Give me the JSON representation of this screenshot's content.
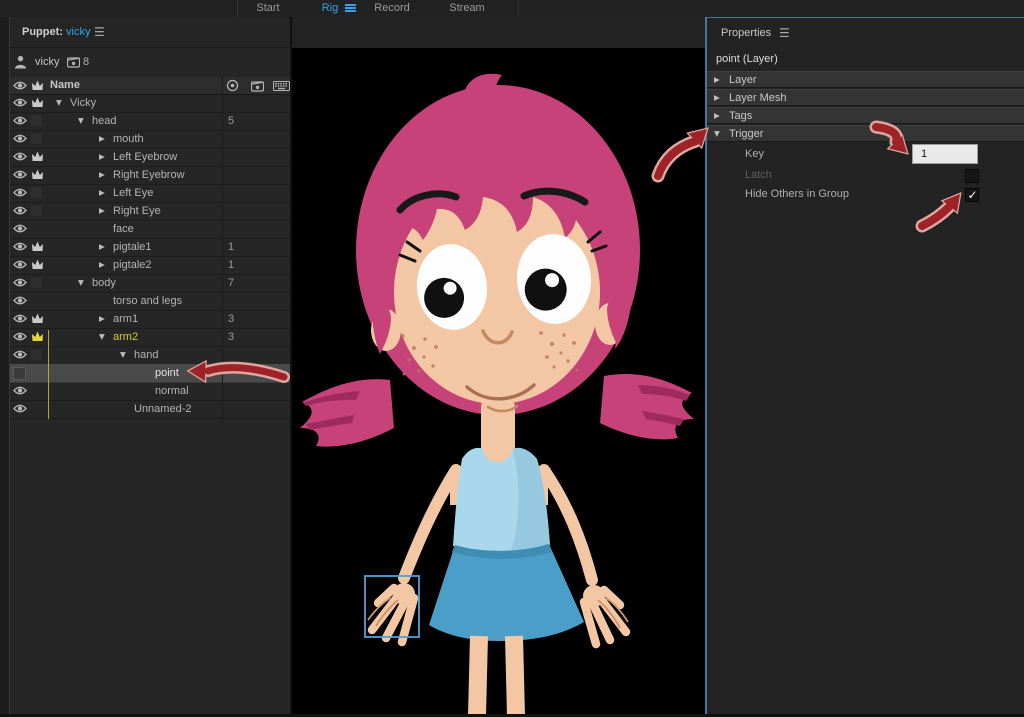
{
  "app": {
    "tabs": [
      {
        "label": "Start",
        "active": false
      },
      {
        "label": "Rig",
        "active": true
      },
      {
        "label": "Record",
        "active": false
      },
      {
        "label": "Stream",
        "active": false
      }
    ]
  },
  "puppet_panel": {
    "title_prefix": "Puppet:",
    "title_name": "vicky",
    "puppet_name": "vicky",
    "trigger_badge_count": "8",
    "name_column_header": "Name",
    "rows": [
      {
        "name": "Vicky",
        "indent": 0,
        "disclosure": "open",
        "eye": true,
        "badge": "crown",
        "value": ""
      },
      {
        "name": "head",
        "indent": 1,
        "disclosure": "open",
        "eye": true,
        "badge": "square",
        "value": "5"
      },
      {
        "name": "mouth",
        "indent": 2,
        "disclosure": "closed",
        "eye": true,
        "badge": "square",
        "value": ""
      },
      {
        "name": "Left Eyebrow",
        "indent": 2,
        "disclosure": "closed",
        "eye": true,
        "badge": "crown",
        "value": ""
      },
      {
        "name": "Right Eyebrow",
        "indent": 2,
        "disclosure": "closed",
        "eye": true,
        "badge": "crown",
        "value": ""
      },
      {
        "name": "Left Eye",
        "indent": 2,
        "disclosure": "closed",
        "eye": true,
        "badge": "square",
        "value": ""
      },
      {
        "name": "Right Eye",
        "indent": 2,
        "disclosure": "closed",
        "eye": true,
        "badge": "square",
        "value": ""
      },
      {
        "name": "face",
        "indent": 2,
        "disclosure": "none",
        "eye": true,
        "badge": "none",
        "value": ""
      },
      {
        "name": "pigtale1",
        "indent": 2,
        "disclosure": "closed",
        "eye": true,
        "badge": "crown",
        "value": "1"
      },
      {
        "name": "pigtale2",
        "indent": 2,
        "disclosure": "closed",
        "eye": true,
        "badge": "crown",
        "value": "1"
      },
      {
        "name": "body",
        "indent": 1,
        "disclosure": "open",
        "eye": true,
        "badge": "square",
        "value": "7"
      },
      {
        "name": "torso and legs",
        "indent": 2,
        "disclosure": "none",
        "eye": true,
        "badge": "none",
        "value": ""
      },
      {
        "name": "arm1",
        "indent": 2,
        "disclosure": "closed",
        "eye": true,
        "badge": "crown",
        "value": "3"
      },
      {
        "name": "arm2",
        "indent": 2,
        "disclosure": "open",
        "eye": true,
        "badge": "crown-yellow",
        "value": "3",
        "yellow": true
      },
      {
        "name": "hand",
        "indent": 3,
        "disclosure": "open",
        "eye": true,
        "badge": "square",
        "value": ""
      },
      {
        "name": "point",
        "indent": 4,
        "disclosure": "none",
        "eye": false,
        "badge": "none",
        "value": "",
        "selected": true
      },
      {
        "name": "normal",
        "indent": 4,
        "disclosure": "none",
        "eye": true,
        "badge": "none",
        "value": ""
      },
      {
        "name": "Unnamed-2",
        "indent": 3,
        "disclosure": "none",
        "eye": true,
        "badge": "none",
        "value": ""
      }
    ]
  },
  "properties_panel": {
    "title": "Properties",
    "subtitle": "point (Layer)",
    "sections": [
      {
        "label": "Layer",
        "expanded": false
      },
      {
        "label": "Layer Mesh",
        "expanded": false
      },
      {
        "label": "Tags",
        "expanded": false
      },
      {
        "label": "Trigger",
        "expanded": true
      }
    ],
    "trigger": {
      "key_label": "Key",
      "key_value": "1",
      "latch_label": "Latch",
      "latch_checked": false,
      "hide_label": "Hide Others in Group",
      "hide_checked": true
    }
  },
  "colors": {
    "accent_blue": "#35a3e8",
    "focus_border": "#44799c",
    "selection_box": "#4ba2dc",
    "highlight_yellow": "#d9c73a",
    "annotation_red": "#9e2227",
    "annotation_outline": "#dca89e",
    "hair": "#c64279",
    "hair_dark": "#9e2a5e",
    "skin": "#f3c6a4",
    "shirt": "#a9d7ec",
    "skirt": "#4a9ec7"
  }
}
